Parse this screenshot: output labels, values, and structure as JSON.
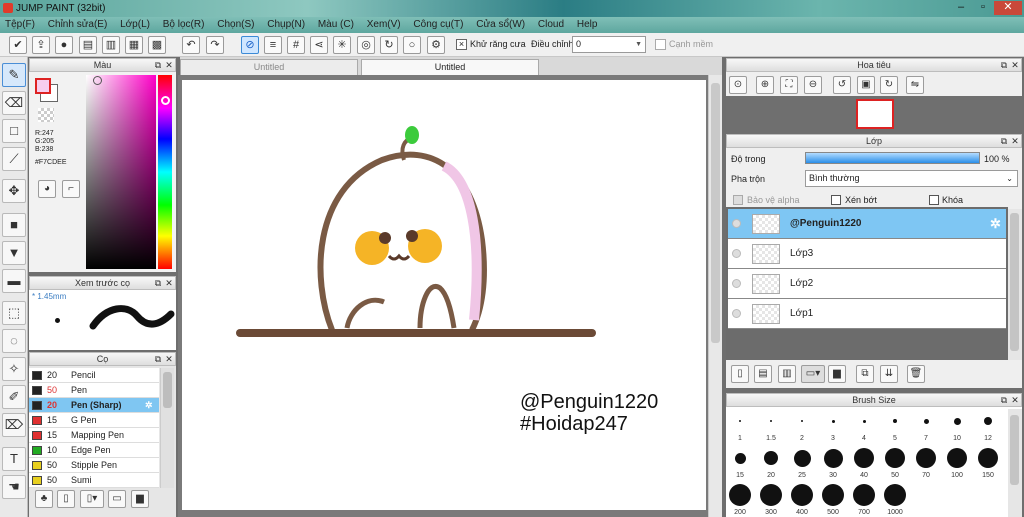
{
  "title": "JUMP PAINT (32bit)",
  "menu": [
    "Tệp(F)",
    "Chỉnh sửa(E)",
    "Lớp(L)",
    "Bộ lọc(R)",
    "Chọn(S)",
    "Chụp(N)",
    "Màu (C)",
    "Xem(V)",
    "Công cụ(T)",
    "Cửa sổ(W)",
    "Cloud",
    "Help"
  ],
  "toolbar": {
    "antialias": "Khử răng cưa",
    "adjust": "Điều chỉnh",
    "adjust_value": "0",
    "edge": "Cạnh mềm"
  },
  "color": {
    "title": "Màu",
    "r": "R:247",
    "g": "G:205",
    "b": "B:238",
    "hex": "#F7CDEE",
    "fg": "#F7CDEE"
  },
  "preview": {
    "title": "Xem trước cọ",
    "size": "1.45mm"
  },
  "brushes": {
    "title": "Cọ",
    "items": [
      {
        "size": "20",
        "name": "Pencil",
        "color": "#222222"
      },
      {
        "size": "50",
        "name": "Pen",
        "color": "#222222"
      },
      {
        "size": "20",
        "name": "Pen (Sharp)",
        "color": "#222222"
      },
      {
        "size": "15",
        "name": "G Pen",
        "color": "#e03030"
      },
      {
        "size": "15",
        "name": "Mapping Pen",
        "color": "#e03030"
      },
      {
        "size": "10",
        "name": "Edge Pen",
        "color": "#22aa22"
      },
      {
        "size": "50",
        "name": "Stipple Pen",
        "color": "#e8d020"
      },
      {
        "size": "50",
        "name": "Sumi",
        "color": "#e8d020"
      }
    ]
  },
  "tabs": [
    "Untitled",
    "Untitled"
  ],
  "canvas": {
    "line1": "@Penguin1220",
    "line2": "#Hoidap247"
  },
  "navigator": {
    "title": "Hoa tiêu"
  },
  "layers": {
    "title": "Lớp",
    "opacity_label": "Độ trong",
    "opacity_value": "100 %",
    "blend_label": "Pha trộn",
    "blend_value": "Bình thường",
    "protect_alpha": "Bảo vệ alpha",
    "clipping": "Xén bớt",
    "lock": "Khóa",
    "items": [
      {
        "name": "@Penguin1220"
      },
      {
        "name": "Lớp3"
      },
      {
        "name": "Lớp2"
      },
      {
        "name": "Lớp1"
      }
    ]
  },
  "brushsize": {
    "title": "Brush Size",
    "sizes": [
      "1",
      "1.5",
      "2",
      "3",
      "4",
      "5",
      "7",
      "10",
      "12",
      "15",
      "20",
      "25",
      "30",
      "40",
      "50",
      "70",
      "100",
      "150",
      "200",
      "300",
      "400",
      "500",
      "700",
      "1000"
    ]
  }
}
